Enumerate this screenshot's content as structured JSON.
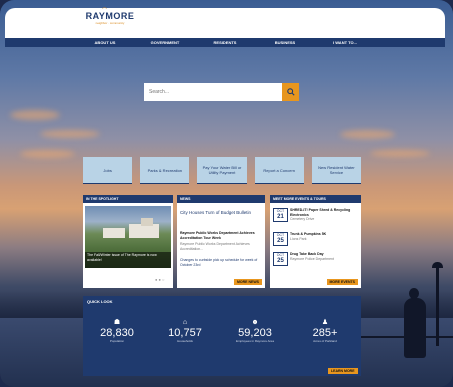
{
  "logo": {
    "name": "RAYMORE",
    "tagline": "neighbor . community"
  },
  "nav": [
    "ABOUT US",
    "GOVERNMENT",
    "RESIDENTS",
    "BUSINESS",
    "I WANT TO..."
  ],
  "search": {
    "placeholder": "Search..."
  },
  "tiles": [
    "Jobs",
    "Parks & Recreation",
    "Pay Your Water Bill or Utility Payment",
    "Report a Concern",
    "New Resident Water Service"
  ],
  "spotlight": {
    "header": "IN THE SPOTLIGHT",
    "caption": "The Fall/Winter issue of The Raymore is now available!",
    "dots": "● ● ○"
  },
  "news": {
    "header": "NEWS",
    "items": [
      {
        "title": "City Houses Turn of Budget Bulletin",
        "meta": ""
      },
      {
        "title": "Raymore Public Works Department Achieves Accreditation Tour Week",
        "meta": "Raymore Public Works Department Achieves Accreditation..."
      },
      {
        "title": "Changes to curbside pick up schedule for week of October 23rd",
        "meta": ""
      }
    ],
    "more": "MORE NEWS"
  },
  "events": {
    "header": "MEET MORE EVENTS & TOURS",
    "items": [
      {
        "month": "OCT",
        "day": "21",
        "title": "SHRED-IT! Paper Shred & Recycling Electronics",
        "meta": "Cemetery Drive"
      },
      {
        "month": "OCT",
        "day": "25",
        "title": "Trunk & Pumpkins 5K",
        "meta": "Lions Park"
      },
      {
        "month": "OCT",
        "day": "25",
        "title": "Drug Take Back Day",
        "meta": "Raymore Police Department"
      }
    ],
    "more": "MORE EVENTS"
  },
  "stats": {
    "header": "QUICK LOOK",
    "items": [
      {
        "icon": "people-icon",
        "value": "28,830",
        "label": "Population"
      },
      {
        "icon": "house-icon",
        "value": "10,757",
        "label": "Households"
      },
      {
        "icon": "group-icon",
        "value": "59,203",
        "label": "Employees in Raymore Area"
      },
      {
        "icon": "person-icon",
        "value": "285+",
        "label": "Acres of Parkland"
      }
    ],
    "learn": "LEARN MORE"
  }
}
